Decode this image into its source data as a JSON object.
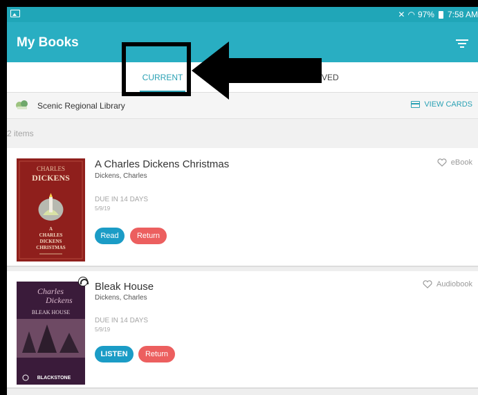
{
  "status_bar": {
    "battery": "97%",
    "time": "7:58 AM"
  },
  "app_bar": {
    "title": "My Books"
  },
  "tabs": {
    "current": "CURRENT",
    "saved_visible": "VED"
  },
  "library": {
    "name": "Scenic Regional Library",
    "view_cards": "VIEW CARDS"
  },
  "items_count": "2 items",
  "books": [
    {
      "title": "A Charles Dickens Christmas",
      "author": "Dickens, Charles",
      "due": "DUE IN 14 DAYS",
      "date": "5/9/19",
      "primary_action": "Read",
      "secondary_action": "Return",
      "format": "eBook",
      "cover": {
        "top_line": "CHARLES",
        "name": "DICKENS",
        "line1": "A",
        "line2": "CHARLES",
        "line3": "DICKENS",
        "line4": "CHRISTMAS"
      }
    },
    {
      "title": "Bleak House",
      "author": "Dickens, Charles",
      "due": "DUE IN 14 DAYS",
      "date": "5/9/19",
      "primary_action": "LISTEN",
      "secondary_action": "Return",
      "format": "Audiobook",
      "cover": {
        "script1": "Charles",
        "script2": "Dickens",
        "title": "BLEAK HOUSE",
        "publisher": "BLACKSTONE"
      }
    }
  ],
  "colors": {
    "app_bar": "#29aec2",
    "accent": "#2aa1b4",
    "read_button": "#1b9cc6",
    "return_button": "#ec5f5f"
  },
  "icons": {
    "filter": "filter-icon",
    "card": "card-icon",
    "heart": "heart-icon",
    "headphones": "headphones-icon"
  }
}
